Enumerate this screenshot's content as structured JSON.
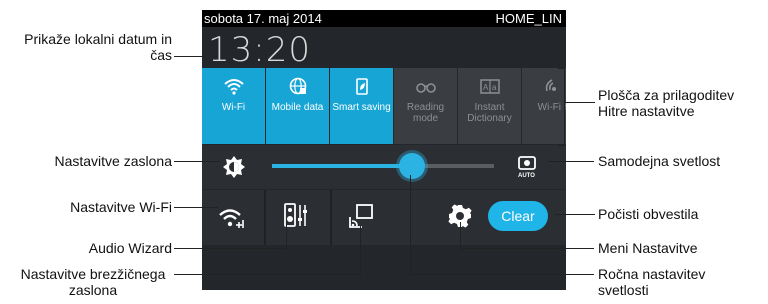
{
  "status_bar": {
    "date": "sobota 17. maj 2014",
    "network": "HOME_LIN"
  },
  "clock": "13:20",
  "tiles": [
    {
      "label": "Wi-Fi",
      "icon": "wifi-icon",
      "state": "on"
    },
    {
      "label": "Mobile data",
      "icon": "globe-icon",
      "state": "on"
    },
    {
      "label": "Smart saving",
      "icon": "smart-saving-icon",
      "state": "on"
    },
    {
      "label": "Reading mode",
      "icon": "glasses-icon",
      "state": "off"
    },
    {
      "label": "Instant Dictionary",
      "icon": "dictionary-icon",
      "state": "off"
    },
    {
      "label": "Wi-Fi h",
      "icon": "wifi-hotspot-icon",
      "state": "off"
    }
  ],
  "brightness": {
    "level": 0.64,
    "auto_label": "AUTO"
  },
  "bottom_row": {
    "clear_label": "Clear"
  },
  "callouts": {
    "left": [
      "Prikaže lokalni datum in čas",
      "Nastavitve zaslona",
      "Nastavitve Wi-Fi",
      "Audio Wizard",
      "Nastavitve brezžičnega zaslona"
    ],
    "right": [
      "Plošča za prilagoditev Hitre nastavitve",
      "Samodejna svetlost",
      "Počisti obvestila",
      "Meni Nastavitve",
      "Ročna nastavitev svetlosti"
    ]
  },
  "colors": {
    "accent": "#17a5d6",
    "panel": "#23262a",
    "row": "#2b2e32"
  }
}
